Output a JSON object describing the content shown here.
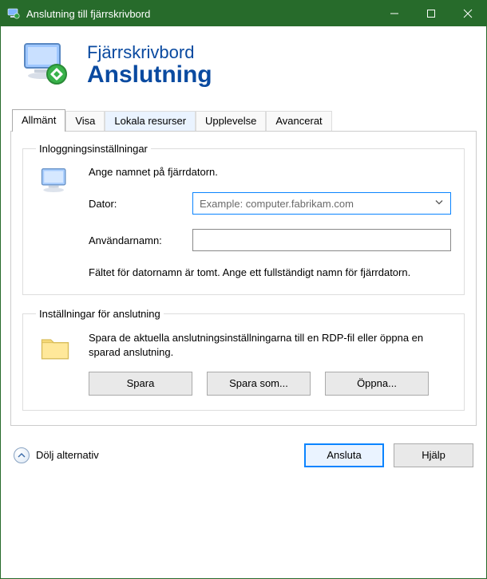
{
  "window": {
    "title": "Anslutning till fjärrskrivbord"
  },
  "header": {
    "line1": "Fjärrskrivbord",
    "line2": "Anslutning"
  },
  "tabs": {
    "general": "Allmänt",
    "display": "Visa",
    "local": "Lokala resurser",
    "experience": "Upplevelse",
    "advanced": "Avancerat"
  },
  "logon": {
    "legend": "Inloggningsinställningar",
    "instruction": "Ange namnet på fjärrdatorn.",
    "computer_label": "Dator:",
    "computer_placeholder": "Example: computer.fabrikam.com",
    "username_label": "Användarnamn:",
    "username_value": "",
    "hint": "Fältet för datornamn är tomt. Ange ett fullständigt namn för fjärrdatorn."
  },
  "connection": {
    "legend": "Inställningar för anslutning",
    "description": "Spara de aktuella anslutningsinställningarna till en RDP-fil eller öppna en sparad anslutning.",
    "save": "Spara",
    "save_as": "Spara som...",
    "open": "Öppna..."
  },
  "footer": {
    "toggle": "Dölj alternativ",
    "connect": "Ansluta",
    "help": "Hjälp"
  }
}
